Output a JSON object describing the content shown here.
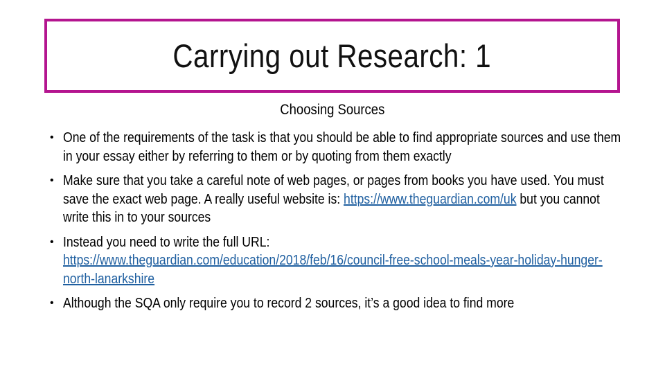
{
  "slide": {
    "title": "Carrying out Research: 1",
    "subtitle": "Choosing Sources",
    "accent_color": "#b4158f",
    "link_color": "#1f5fa0",
    "bullets": [
      {
        "text_before": "One of the requirements of the task is that you should be able to find appropriate sources and use them in your essay either by referring to them or by quoting from them exactly",
        "link": "",
        "text_after": ""
      },
      {
        "text_before": "Make sure that you take a careful note of web pages, or pages from books you have used. You must save the exact web page. A really useful website is: ",
        "link": "https://www.theguardian.com/uk",
        "text_after": " but you cannot write this in to your sources"
      },
      {
        "text_before": "Instead you need to write the full URL: ",
        "link": "https://www.theguardian.com/education/2018/feb/16/council-free-school-meals-year-holiday-hunger-north-lanarkshire",
        "text_after": ""
      },
      {
        "text_before": "Although the SQA only require you to record 2 sources, it’s a good idea to find more",
        "link": "",
        "text_after": ""
      }
    ],
    "bullet_glyph": "•"
  }
}
